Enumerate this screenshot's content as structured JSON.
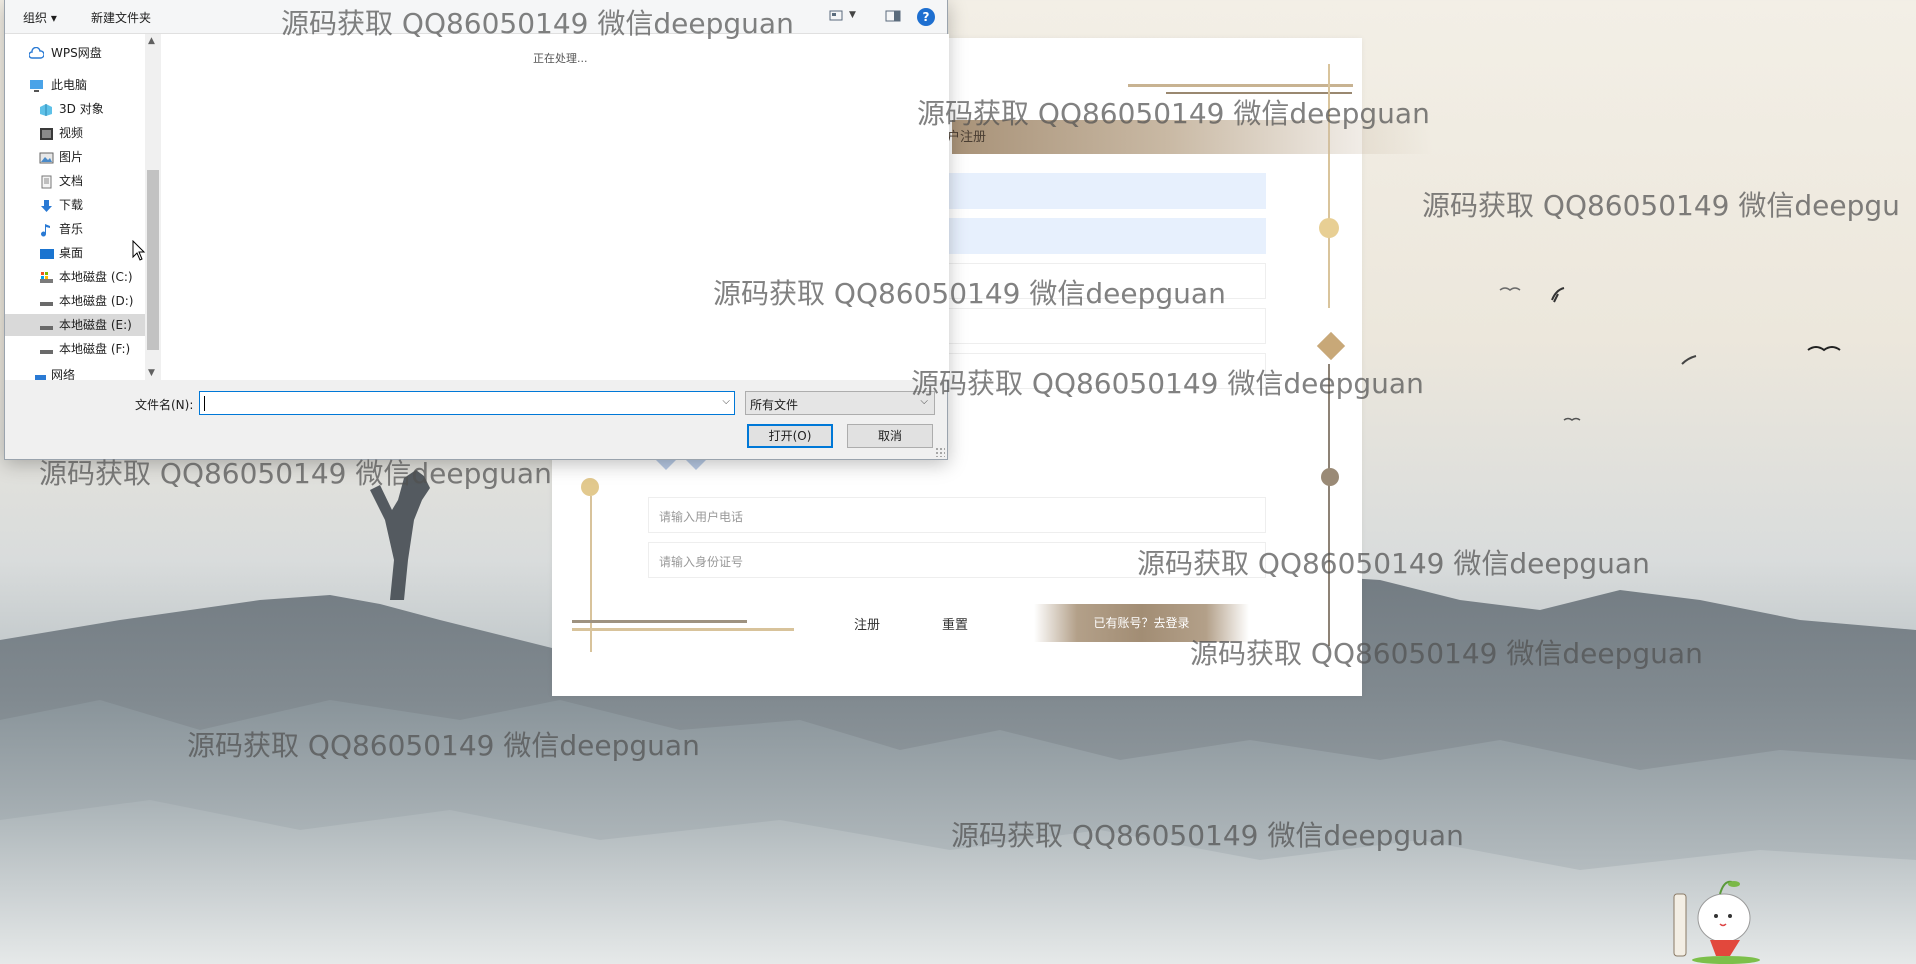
{
  "dialog": {
    "toolbar": {
      "organize": "组织 ▾",
      "new_folder": "新建文件夹",
      "help": "?"
    },
    "nav_items": [
      {
        "label": "WPS网盘",
        "icon": "cloud-icon"
      },
      {
        "label": "此电脑",
        "icon": "computer-icon"
      },
      {
        "label": "3D 对象",
        "icon": "cube-icon"
      },
      {
        "label": "视频",
        "icon": "video-icon"
      },
      {
        "label": "图片",
        "icon": "picture-icon"
      },
      {
        "label": "文档",
        "icon": "document-icon"
      },
      {
        "label": "下载",
        "icon": "download-icon"
      },
      {
        "label": "音乐",
        "icon": "music-icon"
      },
      {
        "label": "桌面",
        "icon": "desktop-icon"
      },
      {
        "label": "本地磁盘 (C:)",
        "icon": "drive-icon"
      },
      {
        "label": "本地磁盘 (D:)",
        "icon": "drive-icon"
      },
      {
        "label": "本地磁盘 (E:)",
        "icon": "drive-icon"
      },
      {
        "label": "本地磁盘 (F:)",
        "icon": "drive-icon"
      },
      {
        "label": "网络",
        "icon": "network-icon"
      }
    ],
    "processing_text": "正在处理...",
    "filename_label": "文件名(N):",
    "filename_value": "",
    "filetype_value": "所有文件",
    "open_button": "打开(O)",
    "cancel_button": "取消"
  },
  "register_card": {
    "title": "户注册",
    "phone_placeholder": "请输入用户电话",
    "idcard_placeholder": "请输入身份证号",
    "register_button": "注册",
    "reset_button": "重置",
    "login_link": "已有账号？去登录"
  },
  "watermark_text": "源码获取 QQ86050149 微信deepguan",
  "watermark_text_cut": "源码获取 QQ86050149 微信deepgu",
  "colors": {
    "accent": "#a28d74",
    "dialog_blue": "#0078d7",
    "field_blue": "#e7f0fd"
  }
}
